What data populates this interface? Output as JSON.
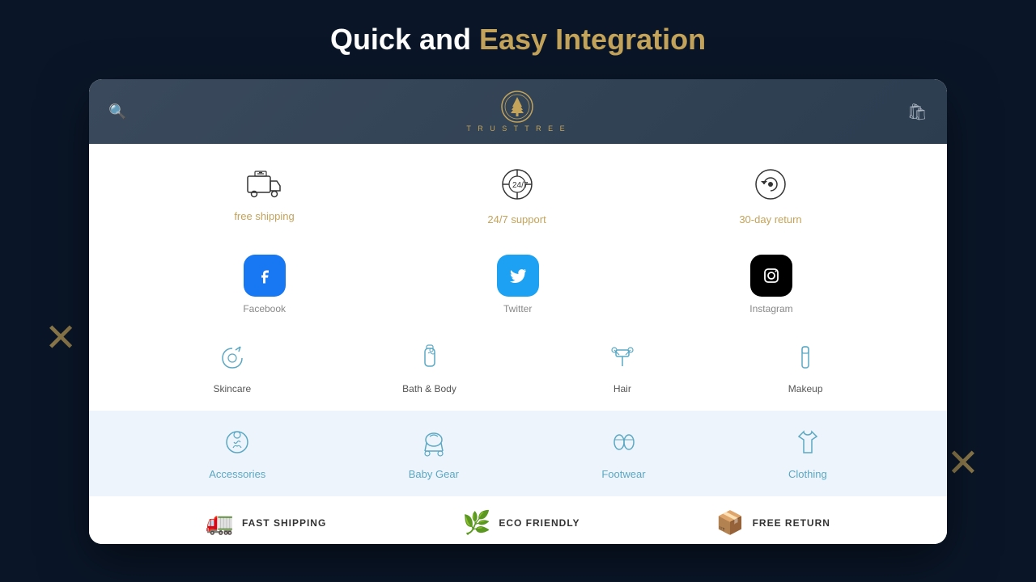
{
  "heading": {
    "text_plain": "Quick and ",
    "text_highlight": "Easy Integration"
  },
  "toolbar": {
    "logo_text": "T R U S T T R E E"
  },
  "features": [
    {
      "id": "free-shipping",
      "icon": "🚚",
      "label": "free shipping"
    },
    {
      "id": "support-24-7",
      "icon": "🕐",
      "label": "24/7 support"
    },
    {
      "id": "return-30-day",
      "icon": "🔄",
      "label": "30-day return"
    }
  ],
  "socials": [
    {
      "id": "facebook",
      "label": "Facebook",
      "class": "facebook",
      "icon": "f"
    },
    {
      "id": "twitter",
      "label": "Twitter",
      "class": "twitter",
      "icon": "🐦"
    },
    {
      "id": "instagram",
      "label": "Instagram",
      "class": "instagram",
      "icon": "📷"
    }
  ],
  "categories_row1": [
    {
      "id": "skincare",
      "icon": "🏷️",
      "label": "Skincare"
    },
    {
      "id": "bath-body",
      "icon": "🧴",
      "label": "Bath & Body"
    },
    {
      "id": "hair",
      "icon": "💈",
      "label": "Hair"
    },
    {
      "id": "makeup",
      "icon": "💄",
      "label": "Makeup"
    }
  ],
  "categories_row2": [
    {
      "id": "accessories",
      "icon": "🎀",
      "label": "Accessories"
    },
    {
      "id": "baby-gear",
      "icon": "🛒",
      "label": "Baby Gear"
    },
    {
      "id": "footwear",
      "icon": "👓",
      "label": "Footwear"
    },
    {
      "id": "clothing",
      "icon": "👕",
      "label": "Clothing"
    }
  ],
  "footer_badges": [
    {
      "id": "fast-shipping-badge",
      "icon": "🚛",
      "label": "FAST SHIPPING"
    },
    {
      "id": "eco-friendly-badge",
      "icon": "🌿",
      "label": "ECO FRIENDLY"
    },
    {
      "id": "free-return-badge",
      "icon": "📦",
      "label": "FREE RETURN"
    }
  ]
}
